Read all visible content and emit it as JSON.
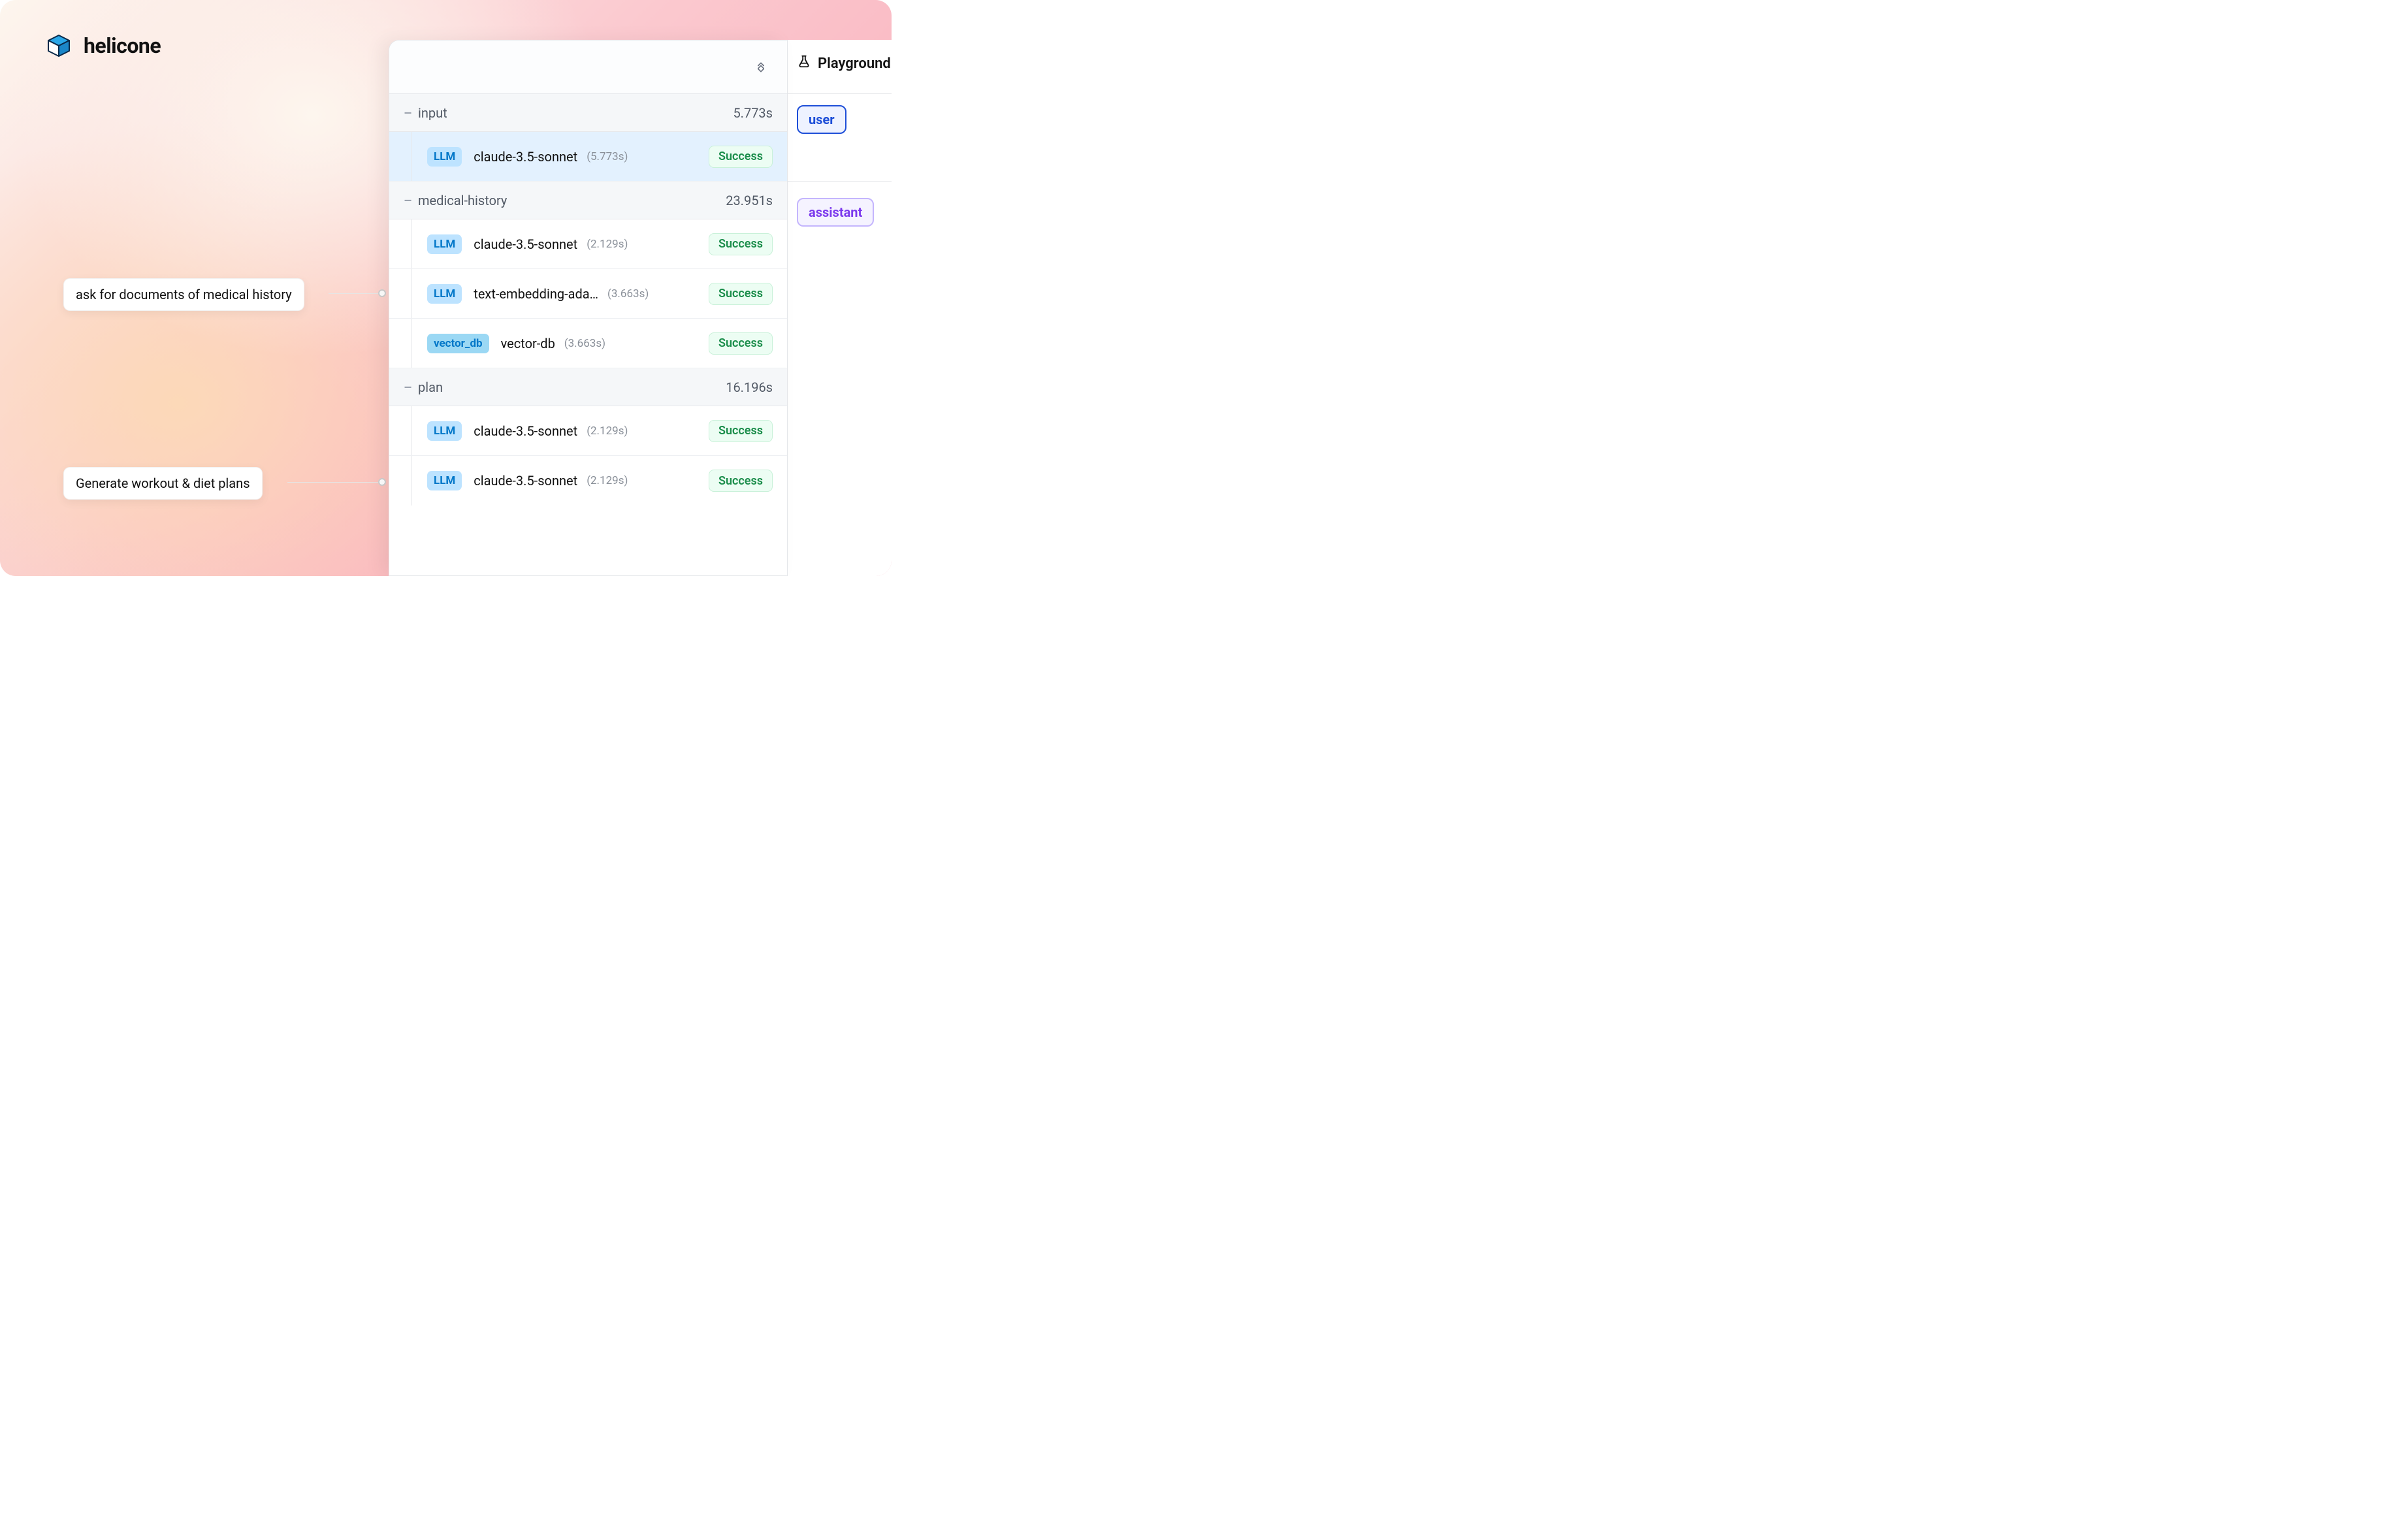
{
  "brand": {
    "name": "helicone"
  },
  "callouts": {
    "medical_history": "ask for documents of medical history",
    "plans": "Generate workout & diet plans"
  },
  "side": {
    "tab_label": "Playground",
    "chips": {
      "user": "user",
      "assistant": "assistant"
    }
  },
  "trace": {
    "groups": [
      {
        "name": "input",
        "time": "5.773s",
        "rows": [
          {
            "tag_type": "LLM",
            "name": "claude-3.5-sonnet",
            "time": "(5.773s)",
            "status": "Success",
            "selected": true
          }
        ]
      },
      {
        "name": "medical-history",
        "time": "23.951s",
        "rows": [
          {
            "tag_type": "LLM",
            "name": "claude-3.5-sonnet",
            "time": "(2.129s)",
            "status": "Success"
          },
          {
            "tag_type": "LLM",
            "name": "text-embedding-ada…",
            "time": "(3.663s)",
            "status": "Success"
          },
          {
            "tag_type": "vector_db",
            "name": "vector-db",
            "time": "(3.663s)",
            "status": "Success"
          }
        ]
      },
      {
        "name": "plan",
        "time": "16.196s",
        "rows": [
          {
            "tag_type": "LLM",
            "name": "claude-3.5-sonnet",
            "time": "(2.129s)",
            "status": "Success"
          },
          {
            "tag_type": "LLM",
            "name": "claude-3.5-sonnet",
            "time": "(2.129s)",
            "status": "Success"
          }
        ]
      }
    ]
  }
}
